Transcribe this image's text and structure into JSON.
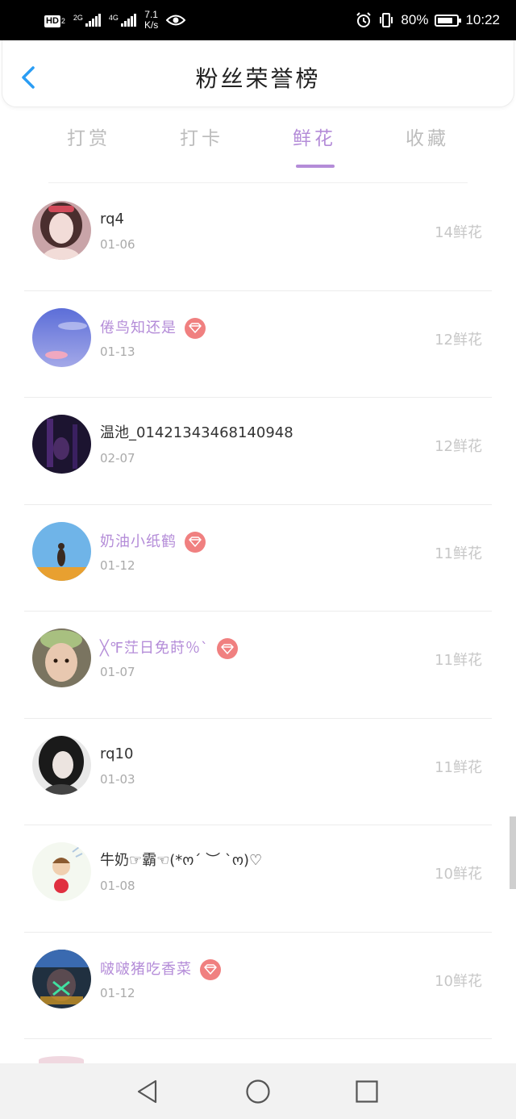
{
  "status_bar": {
    "hd_label": "HD",
    "hd_sub": "2",
    "sig1_label": "2G",
    "sig2_label": "4G",
    "net_speed_value": "7.1",
    "net_speed_unit": "K/s",
    "battery_text": "80%",
    "battery_level": 0.8,
    "time": "10:22"
  },
  "header": {
    "title": "粉丝荣誉榜"
  },
  "tabs": [
    {
      "label": "打赏",
      "active": false
    },
    {
      "label": "打卡",
      "active": false
    },
    {
      "label": "鲜花",
      "active": true
    },
    {
      "label": "收藏",
      "active": false
    }
  ],
  "fans": [
    {
      "name": "rq4",
      "date": "01-06",
      "score": "14鲜花",
      "vip": false
    },
    {
      "name": "倦鸟知还是",
      "date": "01-13",
      "score": "12鲜花",
      "vip": true
    },
    {
      "name": "温池_01421343468140948",
      "date": "02-07",
      "score": "12鲜花",
      "vip": false
    },
    {
      "name": "奶油小纸鹤",
      "date": "01-12",
      "score": "11鲜花",
      "vip": true
    },
    {
      "name": "╳℉茳日免莳％ˋ",
      "date": "01-07",
      "score": "11鲜花",
      "vip": true
    },
    {
      "name": "rq10",
      "date": "01-03",
      "score": "11鲜花",
      "vip": false
    },
    {
      "name": "牛奶☞霸☜(*ო´ ︶ `ო)♡",
      "date": "01-08",
      "score": "10鲜花",
      "vip": false
    },
    {
      "name": "啵啵猪吃香菜",
      "date": "01-12",
      "score": "10鲜花",
      "vip": true
    }
  ],
  "colors": {
    "accent": "#b48cd8",
    "vip_badge": "#f08080",
    "inactive_tab": "#bdbdbd",
    "back_arrow": "#2a9df4"
  },
  "icons": {
    "back": "back-arrow-icon",
    "vip": "diamond-icon",
    "nav_back": "triangle-back-icon",
    "nav_home": "circle-home-icon",
    "nav_recent": "square-recent-icon"
  }
}
